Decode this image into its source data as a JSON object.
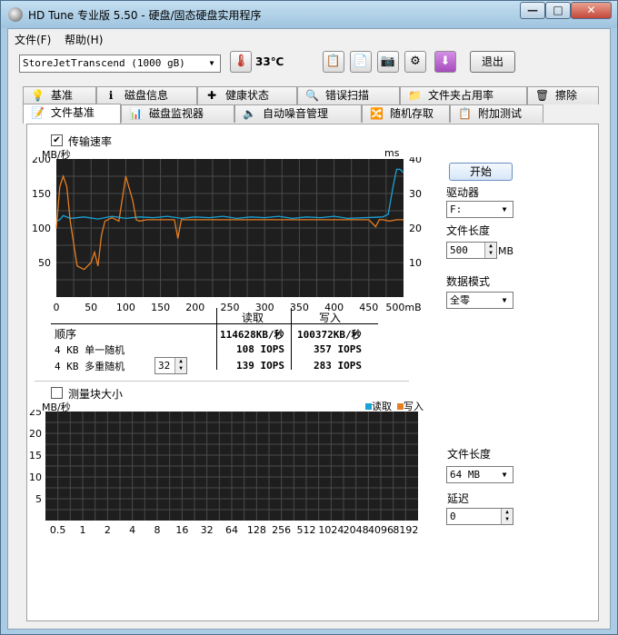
{
  "window": {
    "title": "HD Tune 专业版 5.50 - 硬盘/固态硬盘实用程序",
    "minimize_label": "—",
    "maximize_label": "□",
    "close_label": "✕"
  },
  "menu": {
    "file": "文件(F)",
    "help": "帮助(H)"
  },
  "toolbar": {
    "drive": "StoreJetTranscend (1000 gB)",
    "temperature": "33℃",
    "exit_label": "退出"
  },
  "tabs_row1": [
    "基准",
    "磁盘信息",
    "健康状态",
    "错误扫描",
    "文件夹占用率",
    "擦除"
  ],
  "tabs_row2": [
    "文件基准",
    "磁盘监视器",
    "自动噪音管理",
    "随机存取",
    "附加测试"
  ],
  "active_tab": "文件基准",
  "transfer": {
    "checkbox_label": "传输速率",
    "checked": true,
    "unit_left": "MB/秒",
    "unit_right": "ms",
    "y_ticks": [
      "200",
      "150",
      "100",
      "50"
    ],
    "ms_ticks": [
      "40",
      "30",
      "20",
      "10"
    ],
    "x_ticks": [
      "0",
      "50",
      "100",
      "150",
      "200",
      "250",
      "300",
      "350",
      "400",
      "450",
      "500mB"
    ]
  },
  "chart_data": [
    {
      "type": "line",
      "title": "",
      "xlabel": "mB",
      "ylabel": "MB/秒",
      "y2label": "ms",
      "xlim": [
        0,
        500
      ],
      "ylim": [
        0,
        200
      ],
      "y2lim": [
        0,
        40
      ],
      "grid": true,
      "series": [
        {
          "name": "读取",
          "color": "#1aa3d6",
          "x": [
            0,
            5,
            10,
            20,
            40,
            60,
            80,
            100,
            120,
            140,
            160,
            180,
            200,
            220,
            240,
            260,
            280,
            300,
            320,
            340,
            360,
            380,
            400,
            420,
            470,
            478,
            485,
            490,
            495,
            500
          ],
          "y": [
            110,
            112,
            118,
            114,
            116,
            113,
            117,
            114,
            116,
            115,
            117,
            114,
            116,
            115,
            117,
            114,
            116,
            115,
            117,
            114,
            116,
            115,
            117,
            114,
            116,
            120,
            160,
            185,
            185,
            180
          ]
        },
        {
          "name": "写入",
          "color": "#e67e22",
          "x": [
            0,
            5,
            10,
            15,
            20,
            30,
            40,
            50,
            55,
            60,
            65,
            70,
            80,
            90,
            100,
            110,
            115,
            120,
            130,
            170,
            175,
            180,
            240,
            300,
            360,
            420,
            450,
            460,
            465,
            470,
            480,
            490,
            500
          ],
          "y": [
            100,
            160,
            175,
            160,
            110,
            45,
            40,
            50,
            65,
            45,
            90,
            110,
            115,
            110,
            175,
            140,
            112,
            110,
            112,
            112,
            85,
            112,
            112,
            112,
            112,
            112,
            112,
            102,
            112,
            112,
            110,
            112,
            112
          ]
        }
      ]
    },
    {
      "type": "bar",
      "title": "",
      "ylabel": "MB/秒",
      "categories": [
        "0.5",
        "1",
        "2",
        "4",
        "8",
        "16",
        "32",
        "64",
        "128",
        "256",
        "512",
        "1024",
        "2048",
        "4096",
        "8192"
      ],
      "ylim": [
        0,
        25
      ],
      "y_ticks": [
        "25",
        "20",
        "15",
        "10",
        "5"
      ],
      "grid": true,
      "series": [
        {
          "name": "读取",
          "color": "#1aa3d6",
          "values": []
        },
        {
          "name": "写入",
          "color": "#e67e22",
          "values": []
        }
      ]
    }
  ],
  "results": {
    "col_read": "读取",
    "col_write": "写入",
    "rows": [
      {
        "label": "顺序",
        "read": "114628KB/秒",
        "write": "100372KB/秒"
      },
      {
        "label": "4 KB 单一随机",
        "read": "108 IOPS",
        "write": "357 IOPS"
      },
      {
        "label": "4 KB 多重随机",
        "read": "139 IOPS",
        "write": "283 IOPS"
      }
    ],
    "queue_depth": "32"
  },
  "right_panel": {
    "start_label": "开始",
    "drive_label": "驱动器",
    "drive_value": "F:",
    "file_length_label": "文件长度",
    "file_length_value": "500",
    "file_length_unit": "MB",
    "data_mode_label": "数据模式",
    "data_mode_value": "全零"
  },
  "block": {
    "checkbox_label": "测量块大小",
    "checked": false,
    "unit": "MB/秒",
    "legend_read": "读取",
    "legend_write": "写入",
    "file_length_label": "文件长度",
    "file_length_value": "64 MB",
    "delay_label": "延迟",
    "delay_value": "0"
  }
}
